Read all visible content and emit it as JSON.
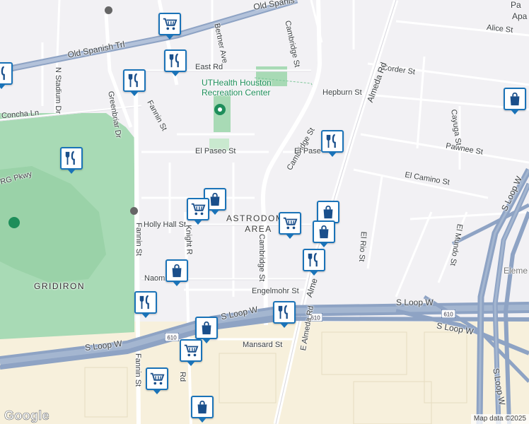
{
  "streets": {
    "old_spanish_trl": "Old Spanish Trl",
    "old_spanish_top": "Old Spanis",
    "cambridge_st_north": "Cambridge St",
    "cambridge_st_mid": "Cambridge St",
    "cambridge_st_south": "Cambridge St",
    "bertner_ave": "Bertner Ave",
    "east_rd": "East Rd",
    "fannin_st_north": "Fannin St",
    "fannin_st_mid": "Fannin St",
    "fannin_st_south": "Fannin St",
    "greenbriar_dr": "Greenbriar Dr",
    "n_stadium_dr": "N Stadium Dr",
    "concha_ln": "Concha Ln",
    "hepburn_st": "Hepburn St",
    "corder_st": "Corder St",
    "alice_st": "Alice St",
    "almeda_rd_north": "Almeda Rd",
    "almeda_rd_south": "Alme",
    "cayuga_st": "Cayuga St",
    "pawnee_st": "Pawnee St",
    "el_paseo_st": "El Paseo St",
    "el_paseo_east": "El Pase",
    "el_camino_st": "El Camino St",
    "holly_hall_st": "Holly Hall St",
    "knight_rd": "Knight R",
    "el_rio_st": "El Rio St",
    "el_mundo_st": "El Mundo St",
    "s_loop_w_right": "S Loop W",
    "s_loop_w_center": "S Loop W",
    "s_loop_w_left": "S Loop W",
    "s_loop_w_east": "S Loop W",
    "s_loop_w_vertical": "S Loop W",
    "s_loop_w_diag": "S Loop W",
    "naomi": "Naom",
    "engelmohr": "Engelmohr St",
    "mansard_st": "Mansard St",
    "e_almeda_rd": "E Almeda Rd",
    "rd_fragment": "Rd",
    "rg_pkwy": "RG Pkwy",
    "pa_fragment": "Pa",
    "apa_fragment": "Apa",
    "elem_fragment": "Eleme"
  },
  "places": {
    "uthealth": "UTHealth Houston\nRecreation Center",
    "astrodome_area": "ASTRODOME\nAREA",
    "gridiron": "GRIDIRON"
  },
  "highway_shield": "610",
  "logo": "Google",
  "attribution": "Map data ©2025",
  "colors": {
    "pin_border": "#1a73b8",
    "pin_icon": "#1a4f8b",
    "park_green": "#a8dab5",
    "highway": "#8ea3c4",
    "background": "#f2f1f4",
    "industrial": "#f7f0dc"
  },
  "pins": [
    {
      "id": "grocery-1",
      "type": "grocery"
    },
    {
      "id": "restaurant-1",
      "type": "restaurant"
    },
    {
      "id": "restaurant-2",
      "type": "restaurant"
    },
    {
      "id": "restaurant-3",
      "type": "restaurant"
    },
    {
      "id": "restaurant-4",
      "type": "restaurant"
    },
    {
      "id": "shopping-1",
      "type": "shopping"
    },
    {
      "id": "grocery-2",
      "type": "grocery"
    },
    {
      "id": "grocery-3",
      "type": "grocery"
    },
    {
      "id": "shopping-2",
      "type": "shopping"
    },
    {
      "id": "shopping-3",
      "type": "shopping"
    },
    {
      "id": "restaurant-5",
      "type": "restaurant"
    },
    {
      "id": "shopping-4",
      "type": "shopping"
    },
    {
      "id": "restaurant-6",
      "type": "restaurant"
    },
    {
      "id": "restaurant-7",
      "type": "restaurant"
    },
    {
      "id": "shopping-5",
      "type": "shopping"
    },
    {
      "id": "grocery-4",
      "type": "grocery"
    },
    {
      "id": "grocery-5",
      "type": "grocery"
    },
    {
      "id": "shopping-6",
      "type": "shopping"
    },
    {
      "id": "shopping-7",
      "type": "shopping"
    },
    {
      "id": "restaurant-8",
      "type": "restaurant"
    }
  ]
}
